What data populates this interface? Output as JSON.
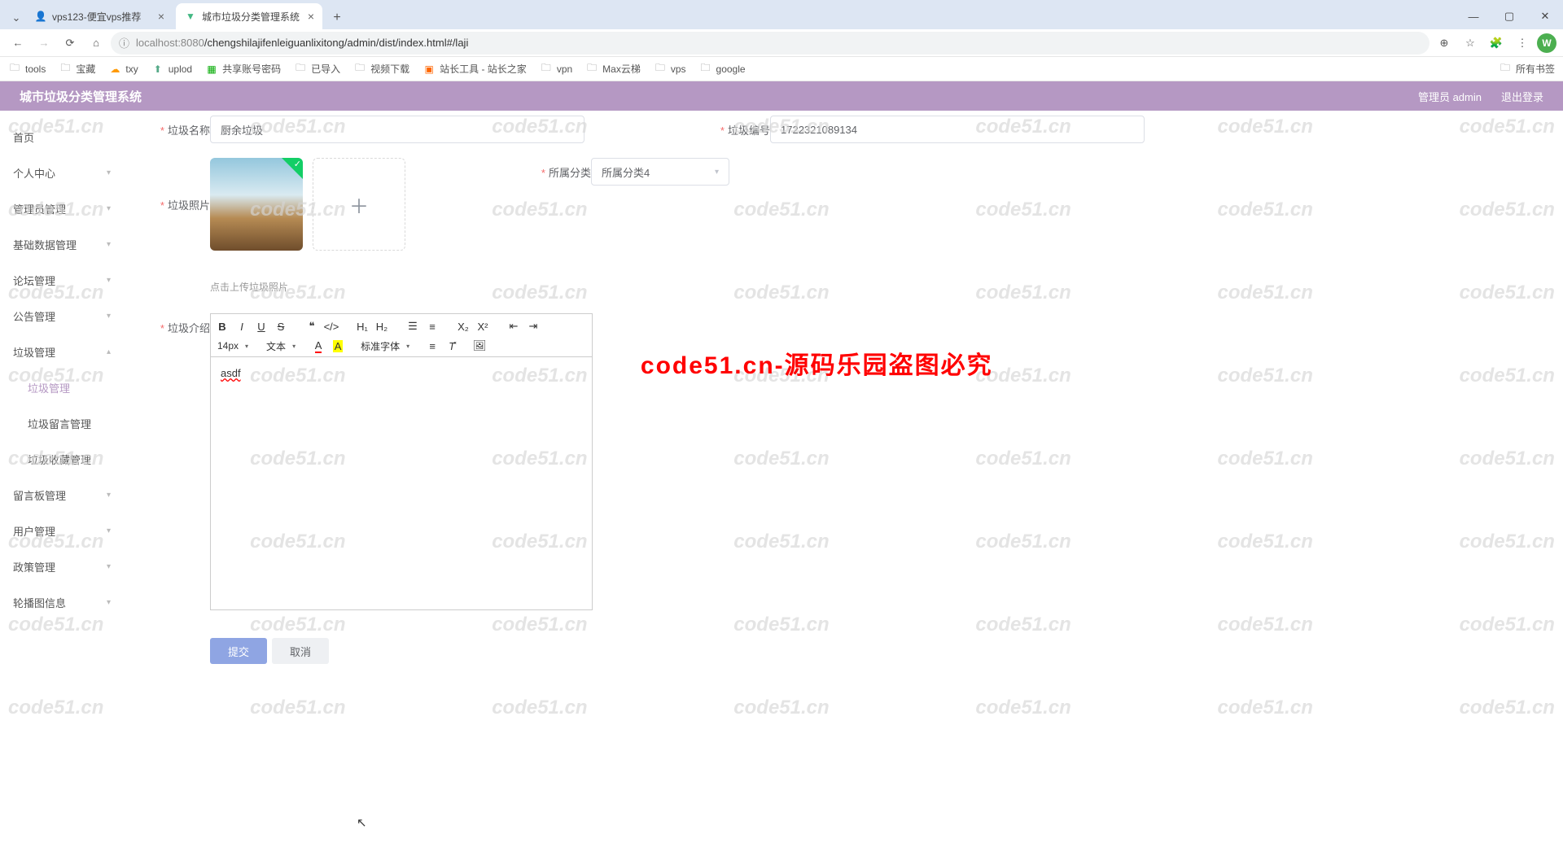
{
  "browser": {
    "tabs": [
      {
        "title": "vps123-便宜vps推荐",
        "favicon": "person"
      },
      {
        "title": "城市垃圾分类管理系统",
        "favicon": "vue"
      }
    ],
    "url_prefix": "localhost:8080",
    "url_path": "/chengshilajifenleiguanlixitong/admin/dist/index.html#/laji",
    "bookmarks": [
      "tools",
      "宝藏",
      "txy",
      "uplod",
      "共享账号密码",
      "已导入",
      "视频下载",
      "站长工具 - 站长之家",
      "vpn",
      "Max云梯",
      "vps",
      "google"
    ],
    "all_bookmarks": "所有书签",
    "profile_initial": "W"
  },
  "app": {
    "title": "城市垃圾分类管理系统",
    "admin_label": "管理员 admin",
    "logout": "退出登录"
  },
  "sidebar": {
    "items": [
      {
        "label": "首页",
        "expandable": false
      },
      {
        "label": "个人中心",
        "expandable": true
      },
      {
        "label": "管理员管理",
        "expandable": true
      },
      {
        "label": "基础数据管理",
        "expandable": true
      },
      {
        "label": "论坛管理",
        "expandable": true
      },
      {
        "label": "公告管理",
        "expandable": true
      },
      {
        "label": "垃圾管理",
        "expandable": true
      },
      {
        "label": "垃圾管理",
        "sub": true,
        "active": true
      },
      {
        "label": "垃圾留言管理",
        "sub": true
      },
      {
        "label": "垃圾收藏管理",
        "sub": true
      },
      {
        "label": "留言板管理",
        "expandable": true
      },
      {
        "label": "用户管理",
        "expandable": true
      },
      {
        "label": "政策管理",
        "expandable": true
      },
      {
        "label": "轮播图信息",
        "expandable": true
      }
    ]
  },
  "form": {
    "name_label": "垃圾名称",
    "name_value": "厨余垃圾",
    "code_label": "垃圾编号",
    "code_value": "1722321089134",
    "category_label": "所属分类",
    "category_value": "所属分类4",
    "photo_label": "垃圾照片",
    "upload_hint": "点击上传垃圾照片",
    "intro_label": "垃圾介绍",
    "intro_value": "asdf",
    "submit": "提交",
    "cancel": "取消"
  },
  "editor": {
    "font_size": "14px",
    "text_type": "文本",
    "font_family": "标准字体"
  },
  "watermark": {
    "text": "code51.cn",
    "banner": "code51.cn-源码乐园盗图必究"
  }
}
